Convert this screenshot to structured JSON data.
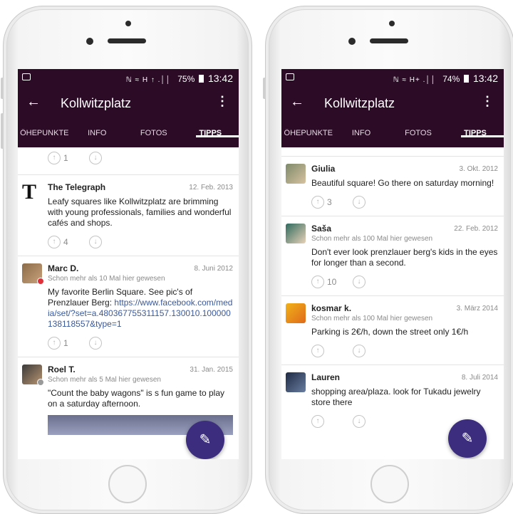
{
  "left": {
    "status": {
      "signal": "ℕ ≈ H ↑ .││",
      "battery": "75%",
      "time": "13:42"
    },
    "appbar": {
      "back": "←",
      "title": "Kollwitzplatz",
      "more": "⋮"
    },
    "tabs": [
      "ÖHEPUNKTE",
      "INFO",
      "FOTOS",
      "TIPPS"
    ],
    "top_votes": {
      "count": "1"
    },
    "tips": [
      {
        "name": "The Telegraph",
        "date": "12. Feb. 2013",
        "text": "Leafy squares like Kollwitzplatz are brimming with young professionals, families and wonderful cafés and shops.",
        "votes": "4",
        "logo": "T"
      },
      {
        "name": "Marc D.",
        "date": "8. Juni 2012",
        "meta": "Schon mehr als 10 Mal hier gewesen",
        "text": "My favorite Berlin Square. See pic's of Prenzlauer Berg:",
        "link": "https://www.facebook.com/media/set/?set=a.480367755311157.130010.100000138118557&type=1",
        "votes": "1"
      },
      {
        "name": "Roel T.",
        "date": "31. Jan. 2015",
        "meta": "Schon mehr als 5 Mal hier gewesen",
        "text": "\"Count the baby wagons\" is s fun game to play on a saturday afternoon."
      }
    ],
    "fab_icon": "edit-icon"
  },
  "right": {
    "status": {
      "signal": "ℕ ≈ H+ .││",
      "battery": "74%",
      "time": "13:42"
    },
    "appbar": {
      "back": "←",
      "title": "Kollwitzplatz",
      "more": "⋮"
    },
    "tabs": [
      "ÖHEPUNKTE",
      "INFO",
      "FOTOS",
      "TIPPS"
    ],
    "tips": [
      {
        "name": "Giulia",
        "date": "3. Okt. 2012",
        "text": "Beautiful square! Go there on saturday morning!",
        "votes": "3"
      },
      {
        "name": "Saša",
        "date": "22. Feb. 2012",
        "meta": "Schon mehr als 100 Mal hier gewesen",
        "text": "Don't ever look prenzlauer berg's kids in the eyes for longer than a second.",
        "votes": "10"
      },
      {
        "name": "kosmar k.",
        "date": "3. März 2014",
        "meta": "Schon mehr als 100 Mal hier gewesen",
        "text": "Parking is 2€/h, down the street only 1€/h",
        "votes": ""
      },
      {
        "name": "Lauren",
        "date": "8. Juli 2014",
        "text": "shopping area/plaza.  look for Tukadu jewelry store there",
        "votes": ""
      }
    ],
    "fab_icon": "edit-icon"
  },
  "colors": {
    "appbar": "#2c0b27",
    "fab": "#3d2d7f",
    "badge_red": "#e0303a",
    "badge_grey": "#9a9a9a"
  }
}
